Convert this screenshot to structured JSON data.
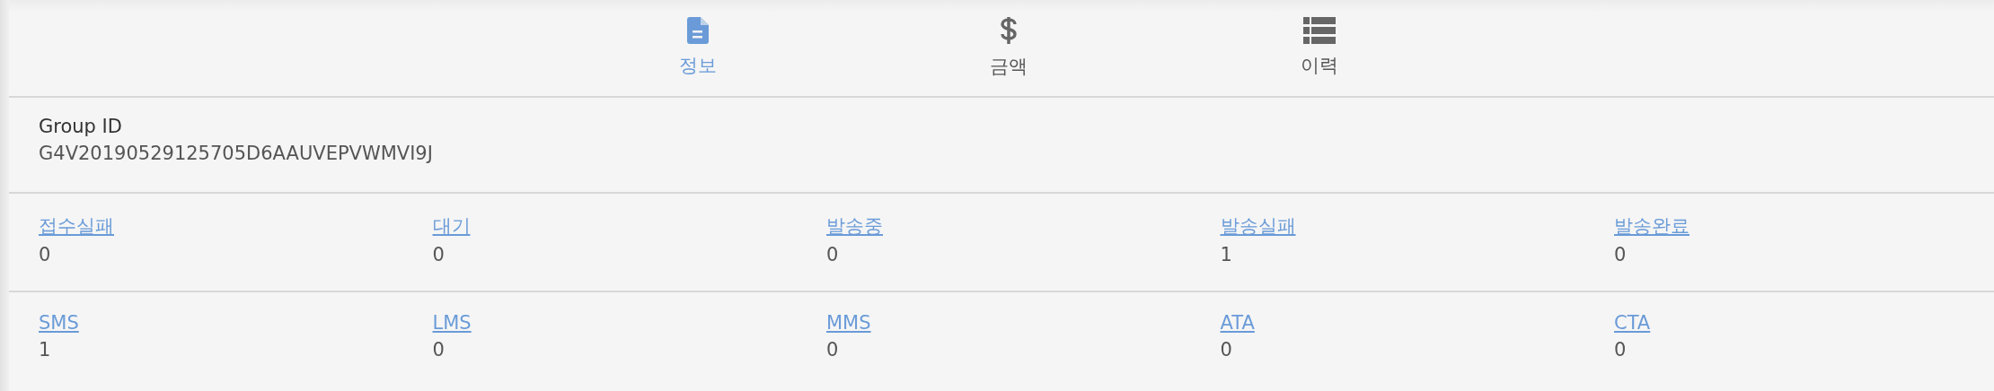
{
  "tabs": [
    {
      "label": "정보",
      "kind": "document",
      "selected": true
    },
    {
      "label": "금액",
      "kind": "dollar",
      "selected": false
    },
    {
      "label": "이력",
      "kind": "list",
      "selected": false
    }
  ],
  "group": {
    "label": "Group ID",
    "value": "G4V20190529125705D6AAUVEPVWMVI9J"
  },
  "status_counts": [
    {
      "label": "접수실패",
      "value": "0"
    },
    {
      "label": "대기",
      "value": "0"
    },
    {
      "label": "발송중",
      "value": "0"
    },
    {
      "label": "발송실패",
      "value": "1"
    },
    {
      "label": "발송완료",
      "value": "0"
    }
  ],
  "type_counts": [
    {
      "label": "SMS",
      "value": "1"
    },
    {
      "label": "LMS",
      "value": "0"
    },
    {
      "label": "MMS",
      "value": "0"
    },
    {
      "label": "ATA",
      "value": "0"
    },
    {
      "label": "CTA",
      "value": "0"
    }
  ]
}
